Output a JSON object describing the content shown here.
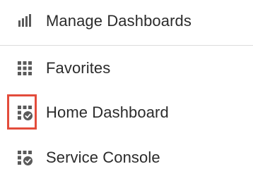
{
  "menu": {
    "items": [
      {
        "label": "Manage Dashboards",
        "icon": "bar-chart-icon"
      },
      {
        "label": "Favorites",
        "icon": "grid-icon"
      },
      {
        "label": "Home Dashboard",
        "icon": "dashboard-check-icon"
      },
      {
        "label": "Service Console",
        "icon": "dashboard-check-icon"
      }
    ]
  },
  "colors": {
    "icon": "#5a5a5a",
    "text": "#2b2b2b",
    "divider": "#dcdcdc",
    "highlight": "#e34c3b"
  }
}
